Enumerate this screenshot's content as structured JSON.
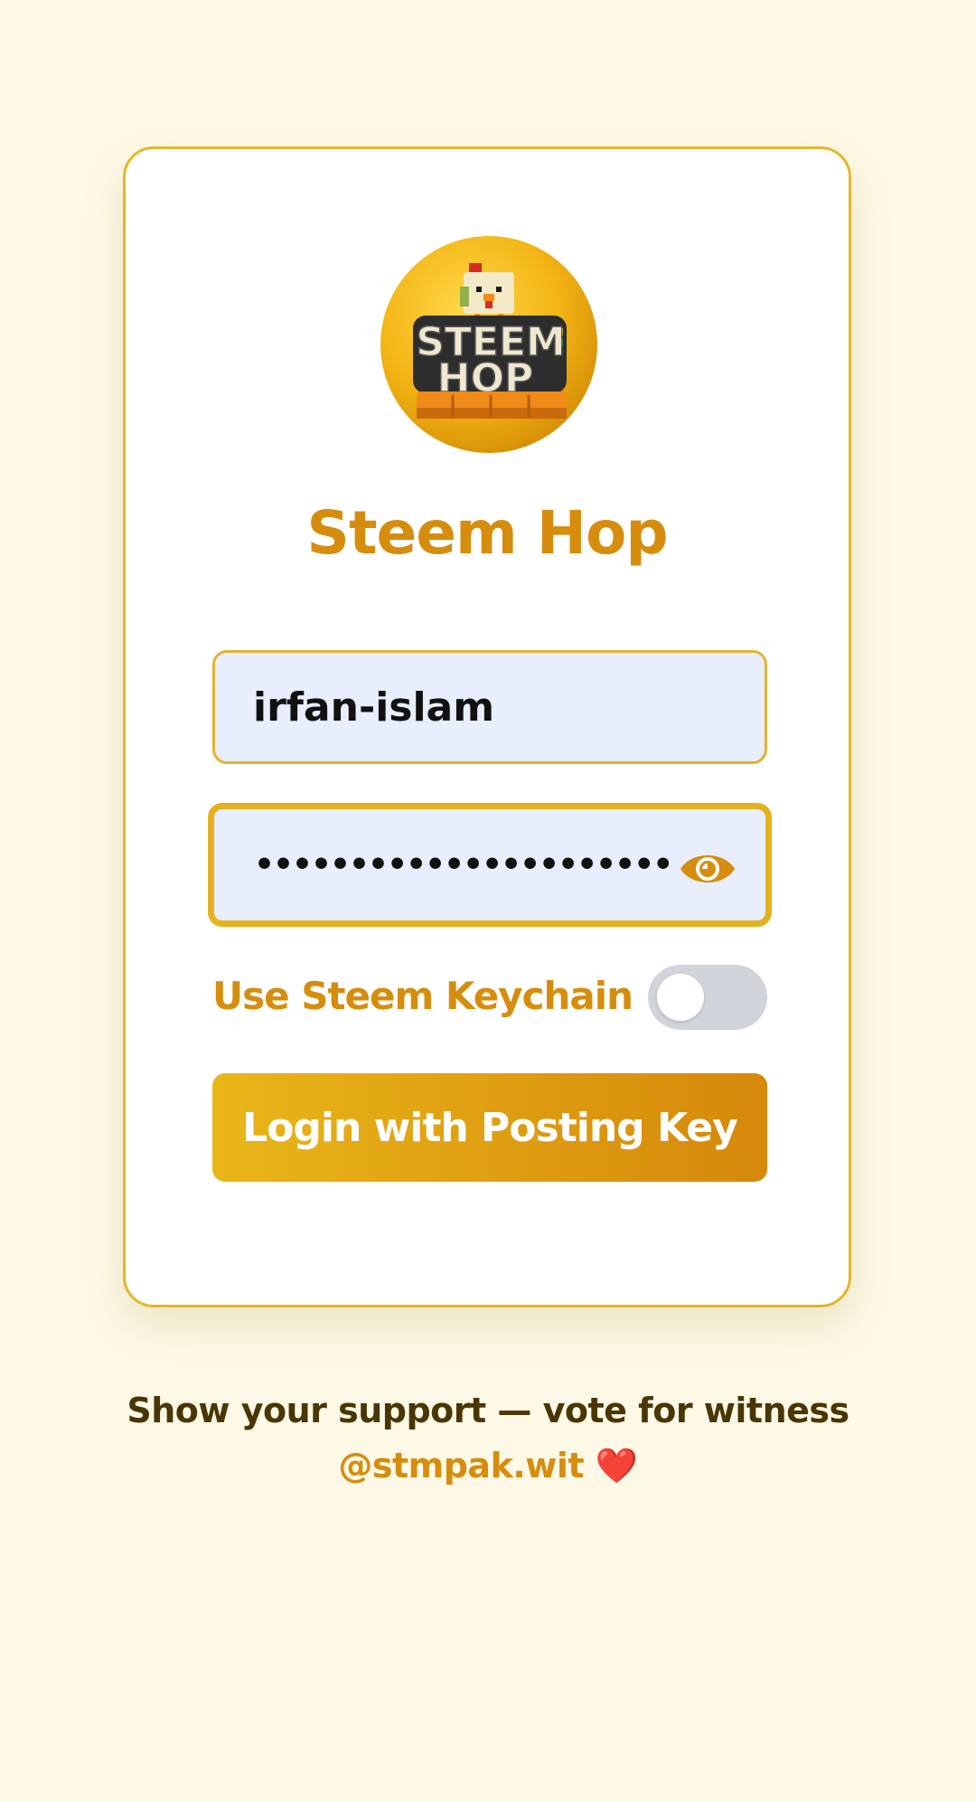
{
  "app": {
    "title": "Steem Hop",
    "logo_name": "steem-hop-logo",
    "logo_text_line1": "STEEM",
    "logo_text_line2": "HOP"
  },
  "login": {
    "username_value": "irfan-islam",
    "password_value": "•••••••••••••••••••••••••••••",
    "password_visibility_icon": "eye-icon",
    "keychain_label": "Use Steem Keychain",
    "keychain_enabled": false,
    "submit_label": "Login with Posting Key"
  },
  "footer": {
    "support_text": "Show your support — vote for witness",
    "witness_link": "@stmpak.wit",
    "heart_icon": "❤️"
  },
  "colors": {
    "background": "#fdf9e6",
    "accent": "#d68d0d",
    "border": "#e4b62a",
    "input_bg": "#e8eefb",
    "button_gradient_start": "#e9b619",
    "button_gradient_end": "#d5880a",
    "footer_text": "#4a3604"
  }
}
